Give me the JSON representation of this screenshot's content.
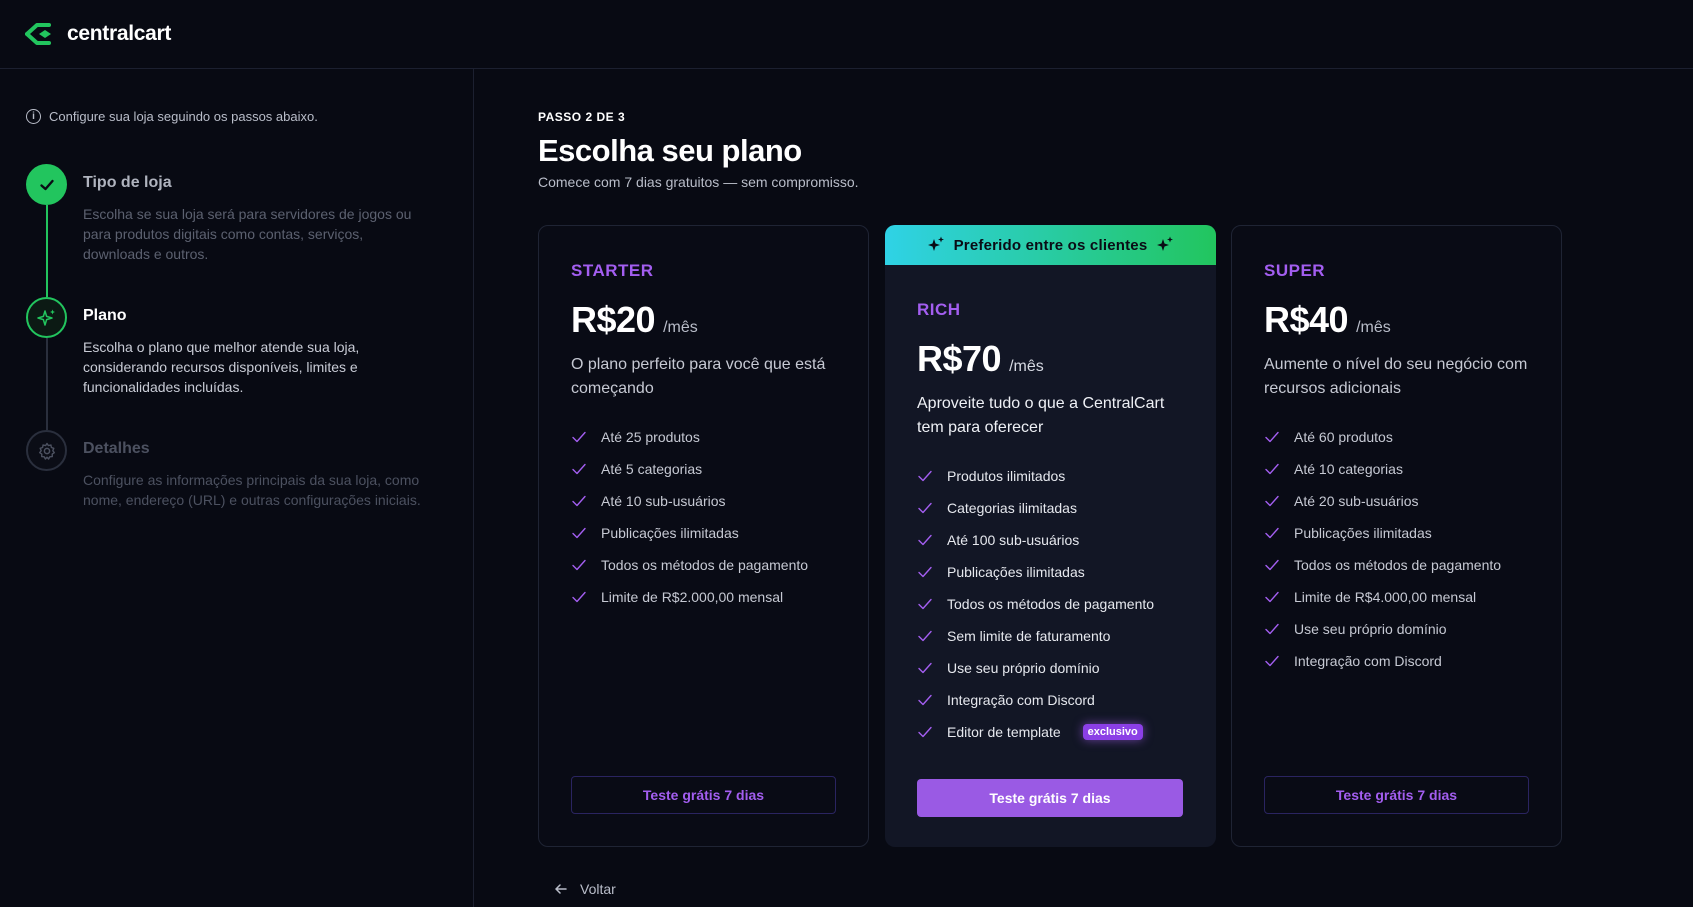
{
  "app": {
    "brand": "centralcart"
  },
  "sidebar": {
    "hint": "Configure sua loja seguindo os passos abaixo.",
    "steps": [
      {
        "title": "Tipo de loja",
        "desc": "Escolha se sua loja será para servidores de jogos ou para produtos digitais como contas, serviços, downloads e outros.",
        "state": "done"
      },
      {
        "title": "Plano",
        "desc": "Escolha o plano que melhor atende sua loja, considerando recursos disponíveis, limites e funcionalidades incluídas.",
        "state": "active"
      },
      {
        "title": "Detalhes",
        "desc": "Configure as informações principais da sua loja, como nome, endereço (URL) e outras configurações iniciais.",
        "state": "pending"
      }
    ]
  },
  "main": {
    "step_indicator": "PASSO 2 DE 3",
    "title": "Escolha seu plano",
    "subtitle": "Comece com 7 dias gratuitos — sem compromisso.",
    "back_label": "Voltar"
  },
  "plans": {
    "starter": {
      "name": "STARTER",
      "price": "R$20",
      "period": "/mês",
      "desc": "O plano perfeito para você que está começando",
      "features": [
        "Até 25 produtos",
        "Até 5 categorias",
        "Até 10 sub-usuários",
        "Publicações ilimitadas",
        "Todos os métodos de pagamento",
        "Limite de R$2.000,00 mensal"
      ],
      "cta": "Teste grátis 7 dias"
    },
    "rich": {
      "banner": "Preferido entre os clientes",
      "name": "RICH",
      "price": "R$70",
      "period": "/mês",
      "desc": "Aproveite tudo o que a CentralCart tem para oferecer",
      "features": [
        "Produtos ilimitados",
        "Categorias ilimitadas",
        "Até 100 sub-usuários",
        "Publicações ilimitadas",
        "Todos os métodos de pagamento",
        "Sem limite de faturamento",
        "Use seu próprio domínio",
        "Integração com Discord",
        "Editor de template"
      ],
      "badge": "exclusivo",
      "cta": "Teste grátis 7 dias"
    },
    "super": {
      "name": "SUPER",
      "price": "R$40",
      "period": "/mês",
      "desc": "Aumente o nível do seu negócio com recursos adicionais",
      "features": [
        "Até 60 produtos",
        "Até 10 categorias",
        "Até 20 sub-usuários",
        "Publicações ilimitadas",
        "Todos os métodos de pagamento",
        "Limite de R$4.000,00 mensal",
        "Use seu próprio domínio",
        "Integração com Discord"
      ],
      "cta": "Teste grátis 7 dias"
    }
  },
  "colors": {
    "accent_green": "#22c55e",
    "accent_purple": "#a35ef0",
    "background": "#080a13"
  }
}
